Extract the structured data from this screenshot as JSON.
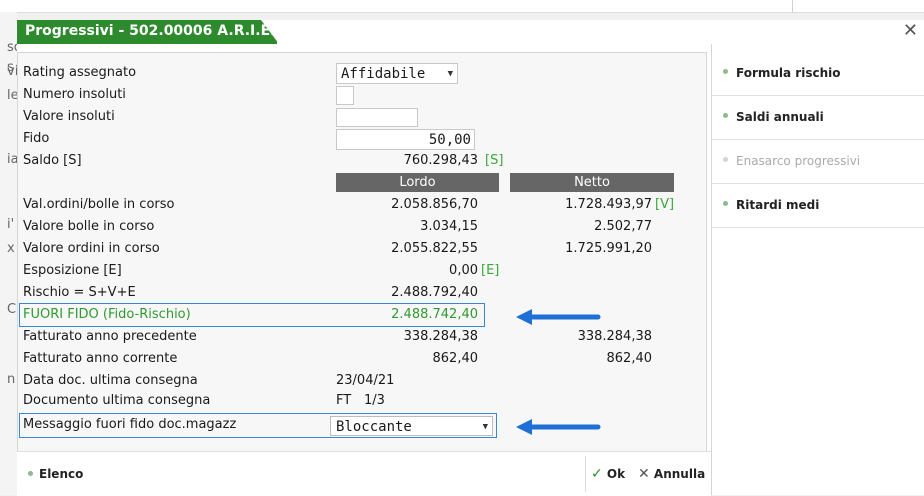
{
  "window": {
    "title": "Progressivi - 502.00006 A.R.I.E.S"
  },
  "background_edge": [
    "s",
    "so",
    "vi",
    "le",
    "ia",
    "i'",
    "x",
    "C",
    "n"
  ],
  "fields": {
    "rating": {
      "label": "Rating assegnato",
      "value": "Affidabile"
    },
    "numero_insoluti": {
      "label": "Numero insoluti",
      "value": ""
    },
    "valore_insoluti": {
      "label": "Valore insoluti",
      "value": ""
    },
    "fido": {
      "label": "Fido",
      "value": "50,00"
    },
    "saldo": {
      "label": "Saldo [S]",
      "value": "760.298,43",
      "tag": "[S]"
    }
  },
  "columns": {
    "lordo": "Lordo",
    "netto": "Netto"
  },
  "rows": [
    {
      "label": "Val.ordini/bolle in corso",
      "lordo": "2.058.856,70",
      "netto": "1.728.493,97",
      "tag": "[V]"
    },
    {
      "label": "Valore bolle in corso",
      "lordo": "3.034,15",
      "netto": "2.502,77"
    },
    {
      "label": "Valore ordini in corso",
      "lordo": "2.055.822,55",
      "netto": "1.725.991,20"
    },
    {
      "label": "Esposizione [E]",
      "lordo": "0,00",
      "tag": "[E]"
    },
    {
      "label": "Rischio  = S+V+E",
      "lordo": "2.488.792,40"
    },
    {
      "label": "FUORI FIDO (Fido-Rischio)",
      "lordo": "2.488.742,40"
    },
    {
      "label": "Fatturato anno precedente",
      "lordo": "338.284,38",
      "netto": "338.284,38"
    },
    {
      "label": "Fatturato anno corrente",
      "lordo": "862,40",
      "netto": "862,40"
    }
  ],
  "ultima_consegna": {
    "data_label": "Data doc. ultima consegna",
    "data_value": "23/04/21",
    "doc_label": "Documento ultima consegna",
    "doc_type": "FT",
    "doc_num": "1/3"
  },
  "messaggio": {
    "label": "Messaggio fuori fido doc.magazz",
    "value": "Bloccante"
  },
  "sidebar": [
    {
      "label": "Formula rischio",
      "enabled": true
    },
    {
      "label": "Saldi annuali",
      "enabled": true
    },
    {
      "label": "Enasarco progressivi",
      "enabled": false
    },
    {
      "label": "Ritardi medi",
      "enabled": true
    }
  ],
  "footer": {
    "elenco": "Elenco",
    "ok": "Ok",
    "annulla": "Annulla"
  },
  "colors": {
    "title_green": "#2d8a2d",
    "value_green": "#3aa83a",
    "highlight_blue": "#3a87d1",
    "arrow_blue": "#1e70d6"
  }
}
